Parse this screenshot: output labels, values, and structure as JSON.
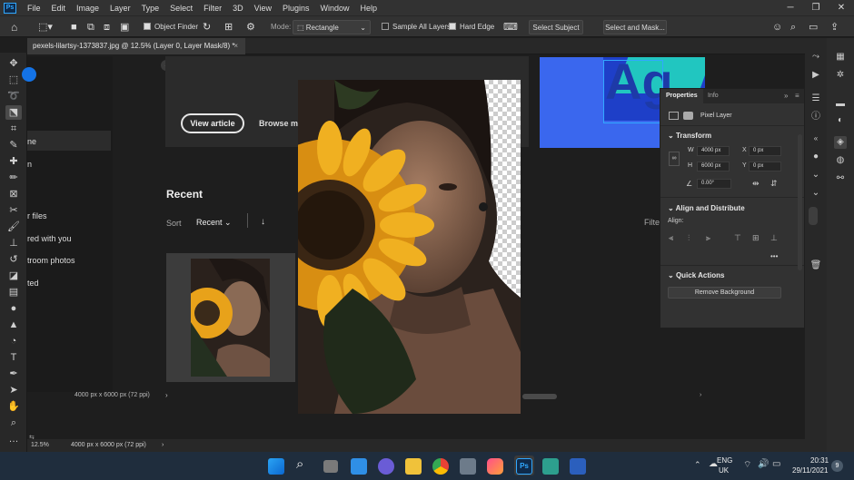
{
  "app": {
    "logo": "Ps"
  },
  "menu": [
    "File",
    "Edit",
    "Image",
    "Layer",
    "Type",
    "Select",
    "Filter",
    "3D",
    "View",
    "Plugins",
    "Window",
    "Help"
  ],
  "options": {
    "object_finder": "Object Finder",
    "mode_label": "Mode:",
    "mode_value": "Rectangle",
    "sample_all_layers": "Sample All Layers",
    "hard_edge": "Hard Edge",
    "select_subject": "Select Subject",
    "select_and_mask": "Select and Mask..."
  },
  "document_tab": {
    "title": "pexels-lilartsy-1373837.jpg @ 12.5% (Layer 0, Layer Mask/8) *",
    "close": "×"
  },
  "home": {
    "left_items": [
      "ne",
      "n",
      "r files",
      "red with you",
      "troom photos",
      "ted"
    ],
    "view_article": "View article",
    "browse": "Browse m",
    "recent_heading": "Recent",
    "sort_label": "Sort",
    "sort_value": "Recent",
    "filter_label": "Filte",
    "thumb_info": "4000 px x 6000 px (72 ppi)",
    "banner_text": "Ag"
  },
  "properties": {
    "tabs": [
      "Properties",
      "Info"
    ],
    "layer_type": "Pixel Layer",
    "transform_title": "Transform",
    "w_label": "W",
    "w_value": "4000 px",
    "h_label": "H",
    "h_value": "6000 px",
    "x_label": "X",
    "x_value": "0 px",
    "y_label": "Y",
    "y_value": "0 px",
    "angle_value": "0.00°",
    "align_title": "Align and Distribute",
    "align_label": "Align:",
    "more": "•••",
    "quick_title": "Quick Actions",
    "remove_bg": "Remove Background"
  },
  "status": {
    "zoom": "12.5%",
    "info": "4000 px x 6000 px (72 ppi)"
  },
  "taskbar": {
    "lang": "ENG",
    "region": "UK",
    "time": "20:31",
    "date": "29/11/2021",
    "notif": "9"
  },
  "colors": {
    "accent": "#31a8ff",
    "banner": "#3a67ee",
    "sunflower": "#e8a21a"
  }
}
